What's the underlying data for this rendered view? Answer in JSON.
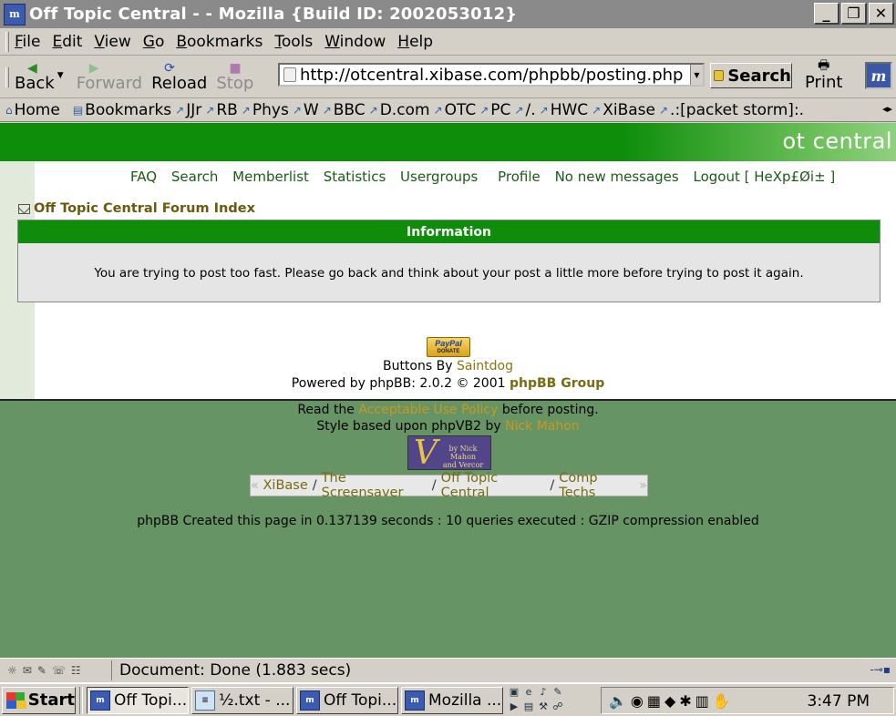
{
  "window": {
    "title": "Off Topic Central - - Mozilla {Build ID: 2002053012}",
    "buttons": [
      "_",
      "❐",
      "✕"
    ]
  },
  "menubar": {
    "items": [
      {
        "underline": "F",
        "rest": "ile"
      },
      {
        "underline": "E",
        "rest": "dit"
      },
      {
        "underline": "V",
        "rest": "iew"
      },
      {
        "underline": "G",
        "rest": "o"
      },
      {
        "underline": "B",
        "rest": "ookmarks"
      },
      {
        "underline": "T",
        "rest": "ools"
      },
      {
        "underline": "W",
        "rest": "indow"
      },
      {
        "underline": "H",
        "rest": "elp"
      }
    ]
  },
  "navbar": {
    "back": "Back",
    "forward": "Forward",
    "reload": "Reload",
    "stop": "Stop",
    "url": "http://otcentral.xibase.com/phpbb/posting.php",
    "search": "Search",
    "print": "Print"
  },
  "personal_toolbar": {
    "items": [
      "Home",
      "Bookmarks",
      "JJr",
      "RB",
      "Phys",
      "W",
      "BBC",
      "D.com",
      "OTC",
      "PC",
      "/.",
      "HWC",
      "XiBase",
      ".:[packet storm]:."
    ]
  },
  "page": {
    "brand": "ot central",
    "nav_links": [
      "FAQ",
      "Search",
      "Memberlist",
      "Statistics",
      "Usergroups",
      "Profile",
      "No new messages",
      "Logout [ HeXp£Øi± ]"
    ],
    "forum_index": "Off Topic Central Forum Index",
    "info_title": "Information",
    "info_message": "You are trying to post too fast. Please go back and think about your post a little more before trying to post it again.",
    "paypal": {
      "top": "PayPal",
      "bottom": "DONATE"
    },
    "buttons_by": "Buttons By ",
    "buttons_by_name": "Saintdog",
    "powered_prefix": "Powered by phpBB: 2.0.2 © 2001 ",
    "powered_group": "phpBB Group",
    "read_prefix": "Read the ",
    "aup_link": "Acceptable Use Policy",
    "read_suffix": " before posting.",
    "style_prefix": "Style based upon phpVB2 by ",
    "style_author": "Nick Mahon",
    "vlogo_mark": "V",
    "vlogo_text_1": "by Nick Mahon",
    "vlogo_text_2": "and Vercor",
    "crumbs": [
      "XiBase",
      "The Screensaver",
      "Off Topic Central",
      "Comp Techs"
    ],
    "crumb_left": "«",
    "crumb_right": "»",
    "crumb_sep": "/",
    "stats": "phpBB Created this page in 0.137139 seconds : 10 queries executed : GZIP compression enabled"
  },
  "statusbar": {
    "text": "Document: Done (1.883 secs)"
  },
  "taskbar": {
    "start": "Start",
    "tasks": [
      {
        "label": "Off Topi...",
        "icon": "mozilla-icon",
        "active": true
      },
      {
        "label": "½.txt - ...",
        "icon": "notepad-icon",
        "active": false
      },
      {
        "label": "Off Topi...",
        "icon": "mozilla-icon",
        "active": false
      },
      {
        "label": "Mozilla ...",
        "icon": "mozilla-icon",
        "active": false
      }
    ],
    "clock": "3:47 PM"
  }
}
